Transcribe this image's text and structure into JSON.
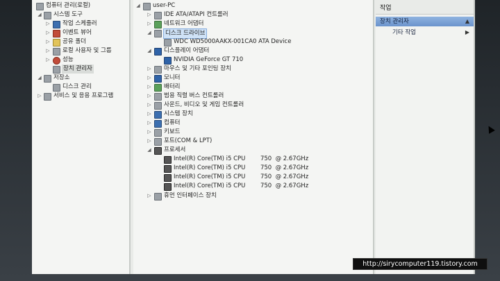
{
  "left_tree": {
    "root": "컴퓨터 관리(로컬)",
    "items": [
      {
        "label": "시스템 도구"
      },
      {
        "label": "작업 스케줄러"
      },
      {
        "label": "이벤트 뷰어"
      },
      {
        "label": "공유 폴더"
      },
      {
        "label": "로컬 사용자 및 그룹"
      },
      {
        "label": "성능"
      },
      {
        "label": "장치 관리자"
      },
      {
        "label": "저장소"
      },
      {
        "label": "디스크 관리"
      },
      {
        "label": "서비스 및 응용 프로그램"
      }
    ]
  },
  "device_tree": {
    "root": "user-PC",
    "items": [
      {
        "label": "IDE ATA/ATAPI 컨트롤러"
      },
      {
        "label": "네트워크 어댑터"
      },
      {
        "label": "디스크 드라이브"
      },
      {
        "label": "WDC WD5000AAKX-001CA0 ATA Device"
      },
      {
        "label": "디스플레이 어댑터"
      },
      {
        "label": "NVIDIA GeForce GT 710"
      },
      {
        "label": "마우스 및 기타 포인팅 장치"
      },
      {
        "label": "모니터"
      },
      {
        "label": "배터리"
      },
      {
        "label": "범용 직렬 버스 컨트롤러"
      },
      {
        "label": "사운드, 비디오 및 게임 컨트롤러"
      },
      {
        "label": "시스템 장치"
      },
      {
        "label": "컴퓨터"
      },
      {
        "label": "키보드"
      },
      {
        "label": "포트(COM & LPT)"
      },
      {
        "label": "프로세서"
      },
      {
        "label": "Intel(R) Core(TM) i5 CPU        750  @ 2.67GHz"
      },
      {
        "label": "Intel(R) Core(TM) i5 CPU        750  @ 2.67GHz"
      },
      {
        "label": "Intel(R) Core(TM) i5 CPU        750  @ 2.67GHz"
      },
      {
        "label": "Intel(R) Core(TM) i5 CPU        750  @ 2.67GHz"
      },
      {
        "label": "휴먼 인터페이스 장치"
      }
    ]
  },
  "actions": {
    "header": "작업",
    "items": [
      {
        "label": "장치 관리자"
      },
      {
        "label": "기타 작업"
      }
    ]
  },
  "watermark": "http://sirycomputer119.tistory.com"
}
